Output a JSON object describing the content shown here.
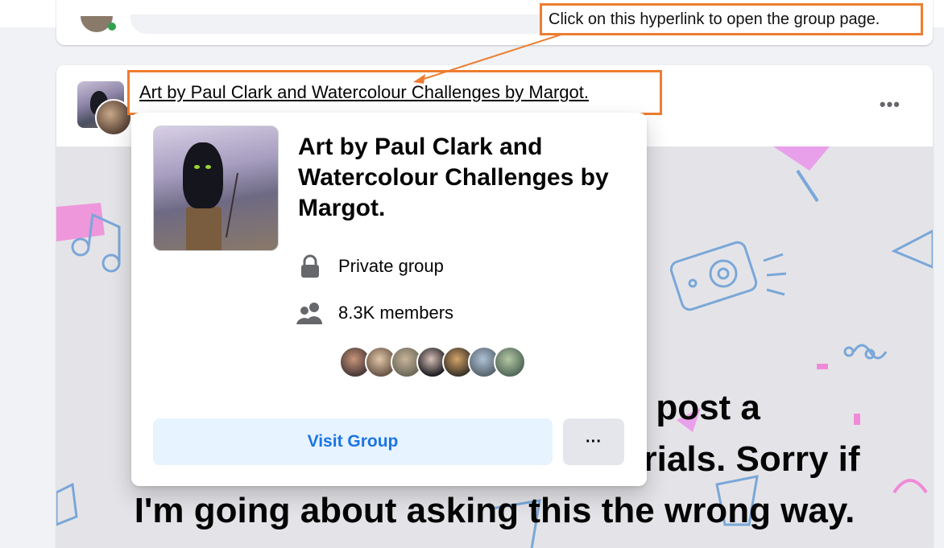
{
  "annotation": {
    "callout_text": "Click on this hyperlink to open the group page.",
    "color": "#ed7d31"
  },
  "post": {
    "group_name": "Art by Paul Clark and Watercolour Challenges by Margot.",
    "more_icon": "more-horizontal-icon",
    "text_lines": [
      "w to post a",
      "p                                                  rials. Sorry if",
      "I'm going about asking this the wrong way."
    ]
  },
  "hover_card": {
    "title": "Art by Paul Clark and Watercolour Challenges by Margot.",
    "privacy": "Private group",
    "privacy_icon": "lock-icon",
    "members": "8.3K members",
    "members_icon": "people-icon",
    "member_faces": 7,
    "visit_label": "Visit Group",
    "more_label": "···"
  },
  "colors": {
    "accent": "#1b74e4",
    "button_bg": "#e7f3ff",
    "text": "#050505",
    "page_bg": "#f0f2f5"
  }
}
